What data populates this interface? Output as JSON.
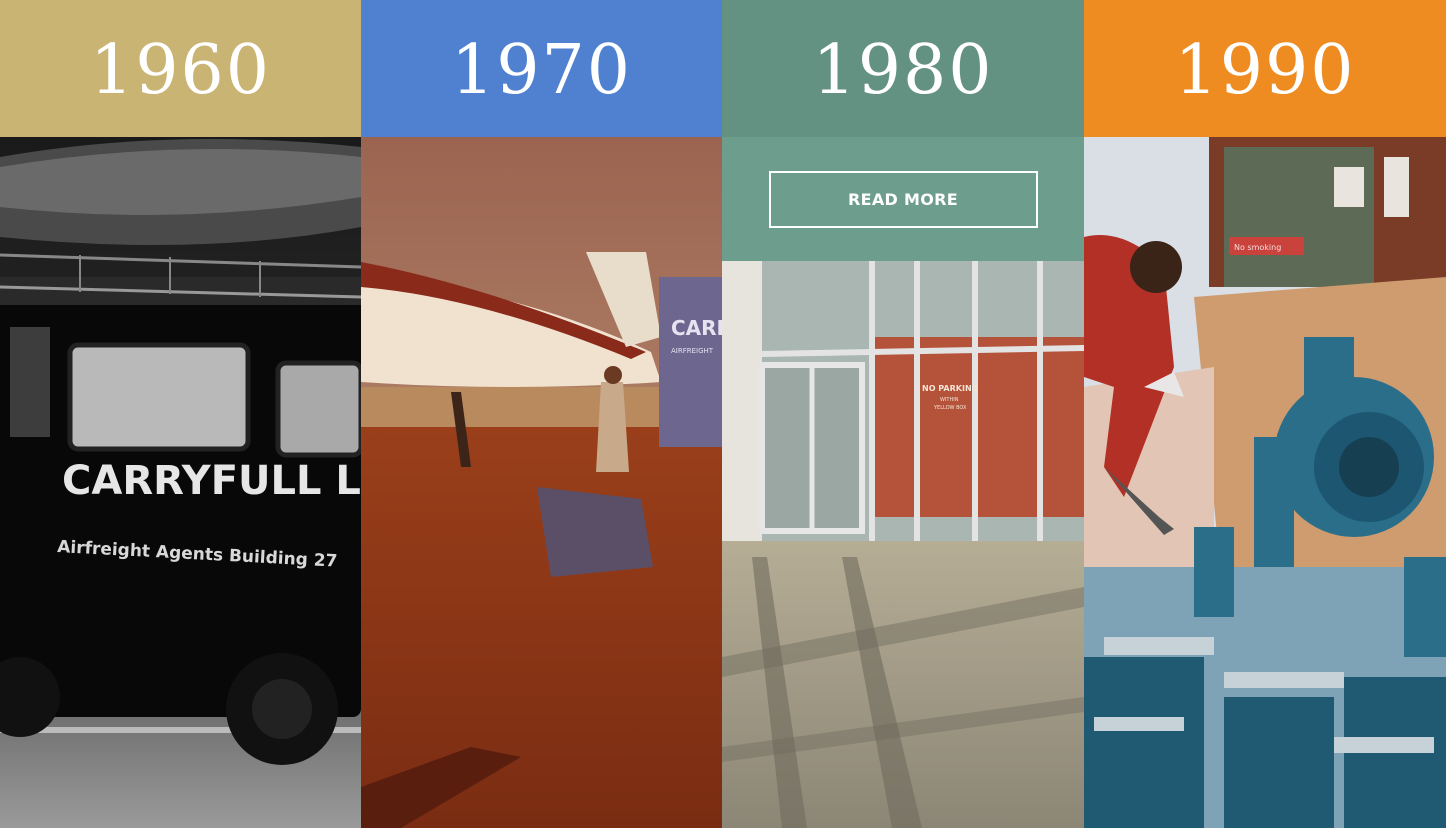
{
  "decades": [
    {
      "year": "1960",
      "color": "#c9b474"
    },
    {
      "year": "1970",
      "color": "#4f81d0"
    },
    {
      "year": "1980",
      "color": "#649282"
    },
    {
      "year": "1990",
      "color": "#ee8c22"
    }
  ],
  "photos": {
    "van_brand": "CARRYFULL L",
    "van_subtitle": "Airfreight Agents Building 27",
    "truck_brand": "CARRY",
    "truck_small": "AIRFREIGHT",
    "door_sign": "NO PARKING",
    "door_sign_small": "WITHIN",
    "door_sign_small2": "YELLOW BOX",
    "red_sign": "No smoking"
  },
  "cta": {
    "read_more_label": "READ MORE"
  }
}
